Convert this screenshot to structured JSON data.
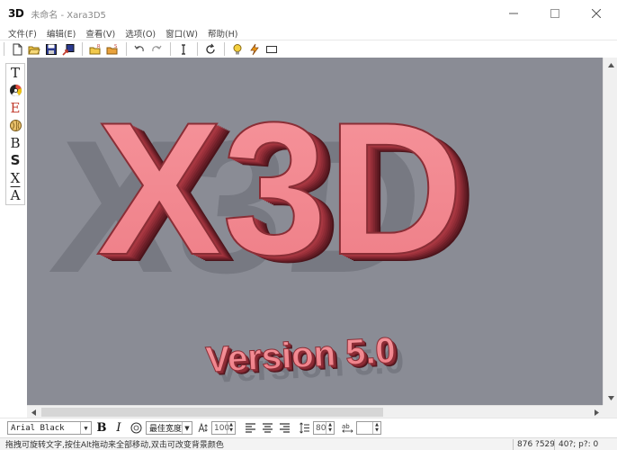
{
  "window": {
    "logo": "3D",
    "title": "未命名 - Xara3D5"
  },
  "menu": [
    {
      "label": "文件(F)"
    },
    {
      "label": "编辑(E)"
    },
    {
      "label": "查看(V)"
    },
    {
      "label": "选项(O)"
    },
    {
      "label": "窗口(W)"
    },
    {
      "label": "帮助(H)"
    }
  ],
  "toolbar_icons": [
    "new-file-icon",
    "open-file-icon",
    "save-icon",
    "export-icon",
    "open-animation-icon",
    "save-animation-icon",
    "undo-icon",
    "redo-icon",
    "text-cursor-icon",
    "rotate-icon",
    "lightbulb-icon",
    "lightning-icon",
    "frame-icon"
  ],
  "left_tools": [
    {
      "icon": "text-tool-icon",
      "glyph": "T"
    },
    {
      "icon": "color-wheel-icon",
      "glyph": ""
    },
    {
      "icon": "edit-text-icon",
      "glyph": "E"
    },
    {
      "icon": "texture-icon",
      "glyph": ""
    },
    {
      "icon": "bevel-icon",
      "glyph": "B"
    },
    {
      "icon": "shadow-icon",
      "glyph": "S"
    },
    {
      "icon": "extrude-icon",
      "glyph": "X"
    },
    {
      "icon": "font-style-icon",
      "glyph": "A"
    }
  ],
  "canvas": {
    "background_color": "#8a8c95",
    "main_text": "X3D",
    "sub_text": "Version 5.0",
    "text_face_color": "#f08a92",
    "text_side_color": "#8a2e36"
  },
  "format_bar": {
    "font": "Arial Black",
    "bold_label": "B",
    "italic_label": "I",
    "width_option": "最佳宽度",
    "size_value": "100",
    "line_spacing_value": "80",
    "char_spacing_value": ""
  },
  "status": {
    "message": "拖拽可旋转文字,按住Alt拖动来全部移动,双击可改变背景颜色",
    "size": "876 ?529",
    "angle": "40?; p?: 0"
  }
}
